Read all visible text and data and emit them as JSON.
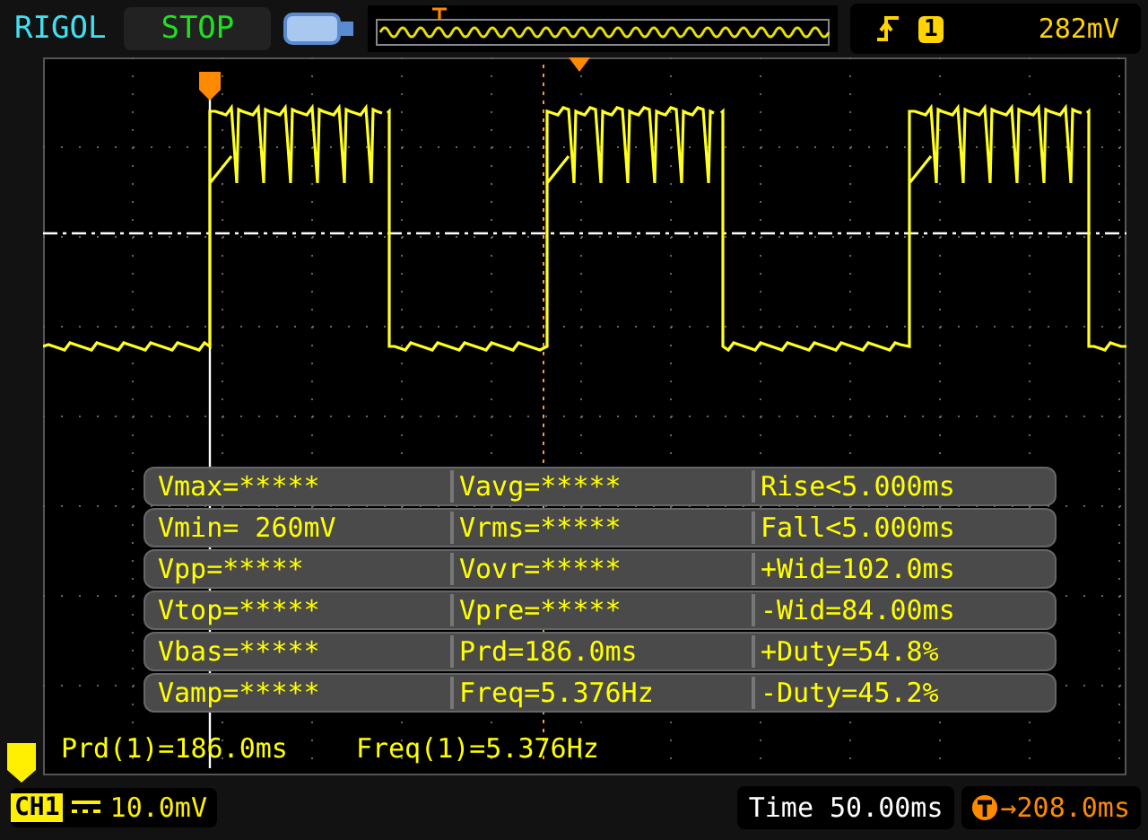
{
  "top_bar": {
    "brand": "RIGOL",
    "run_state": "STOP",
    "trigger": {
      "channel": "1",
      "level": "282mV"
    }
  },
  "measurements": [
    {
      "cells": [
        "Vmax=*****",
        "Vavg=*****",
        "Rise<5.000ms"
      ]
    },
    {
      "cells": [
        "Vmin= 260mV",
        "Vrms=*****",
        "Fall<5.000ms"
      ]
    },
    {
      "cells": [
        "Vpp=*****",
        "Vovr=*****",
        "+Wid=102.0ms"
      ]
    },
    {
      "cells": [
        "Vtop=*****",
        "Vpre=*****",
        "-Wid=84.00ms"
      ]
    },
    {
      "cells": [
        "Vbas=*****",
        "Prd=186.0ms",
        "+Duty=54.8%"
      ]
    },
    {
      "cells": [
        "Vamp=*****",
        "Freq=5.376Hz",
        "-Duty=45.2%"
      ]
    }
  ],
  "readouts": [
    "Prd(1)=186.0ms",
    "Freq(1)=5.376Hz"
  ],
  "bottom_bar": {
    "channel": "CH1",
    "scale": "10.0mV",
    "time": "Time 50.00ms",
    "trigger_offset": "→208.0ms"
  }
}
